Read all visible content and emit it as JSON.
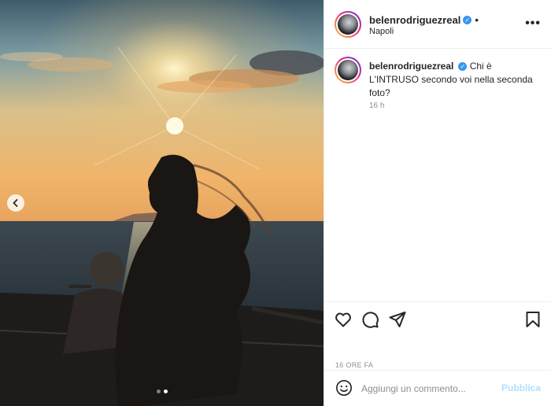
{
  "post": {
    "username": "belenrodriguezreal",
    "verified": true,
    "header_separator": "•",
    "location": "Napoli",
    "more_icon": "more-horizontal-icon",
    "caption": {
      "text": "Chi è L'INTRUSO secondo voi nella seconda foto?",
      "time": "16 h"
    },
    "date": "16 ORE FA",
    "carousel": {
      "slides": 2,
      "active_slide": 2
    }
  },
  "actions": {
    "like_icon": "heart-icon",
    "comment_icon": "comment-icon",
    "share_icon": "share-icon",
    "save_icon": "bookmark-icon"
  },
  "comment_box": {
    "placeholder": "Aggiungi un commento...",
    "publish_label": "Pubblica",
    "emoji_icon": "emoji-icon"
  },
  "colors": {
    "verified_badge": "#3897f0",
    "publish_disabled": "#b2dffc",
    "secondary_text": "#8e8e8e",
    "divider": "#efefef"
  }
}
